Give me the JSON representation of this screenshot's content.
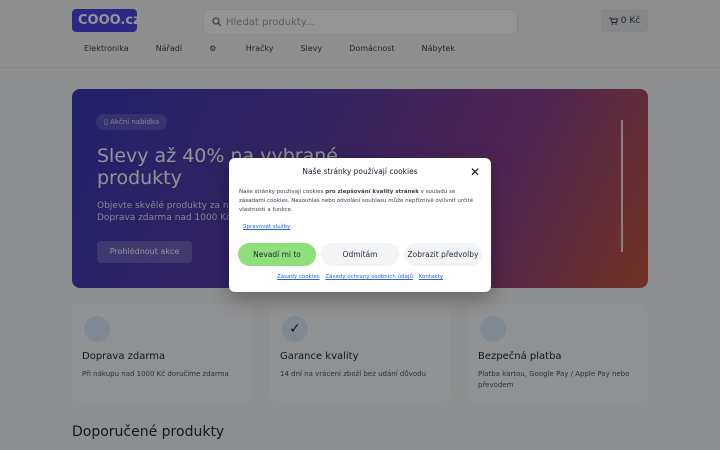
{
  "header": {
    "logo": "COOO.cz",
    "search_placeholder": "Hledat produkty...",
    "cart_label": "0 Kč",
    "nav": [
      "Elektronika",
      "Nářadí",
      "Hračky",
      "Slevy",
      "Domácnost",
      "Nábytek"
    ]
  },
  "hero": {
    "badge": "Akční nabídka",
    "title": "Slevy až 40% na vybrané produkty",
    "subtitle": "Objevte skvělé produkty za nejlepší ceny. Doprava zdarma nad 1000 Kč.",
    "button": "Prohlédnout akce"
  },
  "features": [
    {
      "icon": "truck-icon",
      "title": "Doprava zdarma",
      "desc": "Při nákupu nad 1000 Kč doručíme zdarma"
    },
    {
      "icon": "check-icon",
      "title": "Garance kvality",
      "desc": "14 dní na vrácení zboží bez udání důvodu"
    },
    {
      "icon": "lock-icon",
      "title": "Bezpečná platba",
      "desc": "Platba kartou, Google Pay / Apple Pay nebo převodem"
    }
  ],
  "section_title": "Doporučené produkty",
  "cookie_modal": {
    "title": "Naše stránky používají cookies",
    "text_pre": "Naše stránky používají cookies ",
    "text_bold": "pro zlepšování kvality stránek",
    "text_post": " v souladu se zásadami cookies. Nesouhlas nebo odvolání souhlasu může nepříznivě ovlivnit určité vlastnosti a funkce.",
    "manage_link": "Spravovat služby",
    "accept": "Nevadí mi to",
    "deny": "Odmítám",
    "prefs": "Zobrazit předvolby",
    "footer_links": [
      "Zásady cookies",
      "Zásady ochrany osobních údajů",
      "Kontakty"
    ]
  },
  "colors": {
    "accent": "#4f46e5",
    "accept_button": "#8ee07a"
  }
}
